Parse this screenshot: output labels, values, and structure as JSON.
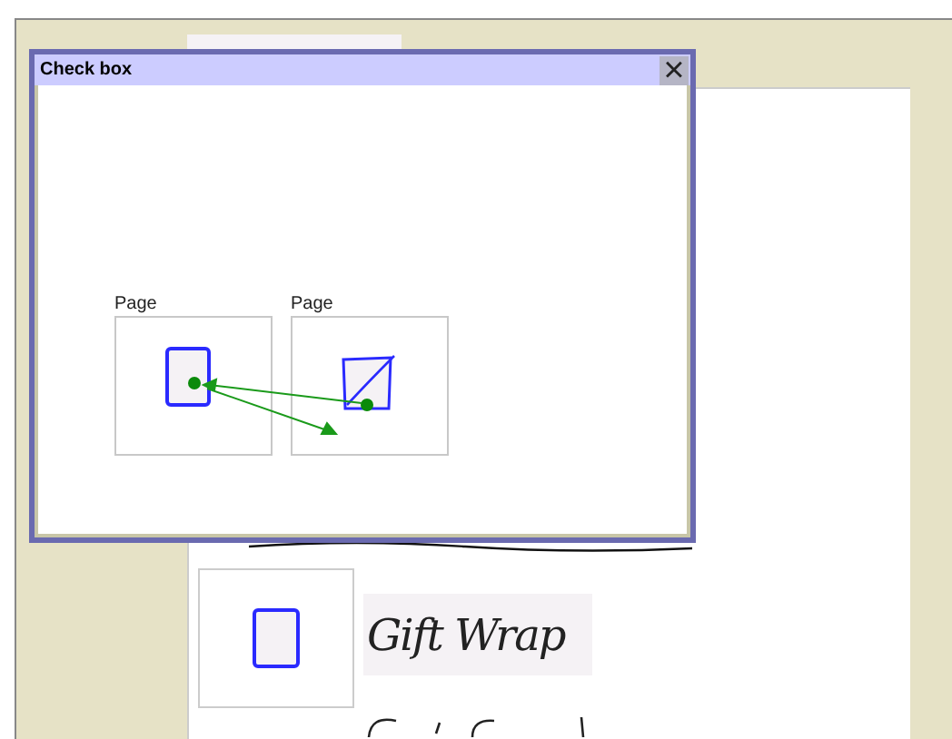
{
  "dialog": {
    "title": "Check box",
    "close": "×",
    "pages": [
      {
        "label": "Page",
        "kind": "empty"
      },
      {
        "label": "Page",
        "kind": "checked"
      }
    ]
  },
  "canvas": {
    "ink_items": [
      {
        "text": "Gift Wrap",
        "kind": "checkbox"
      }
    ]
  }
}
